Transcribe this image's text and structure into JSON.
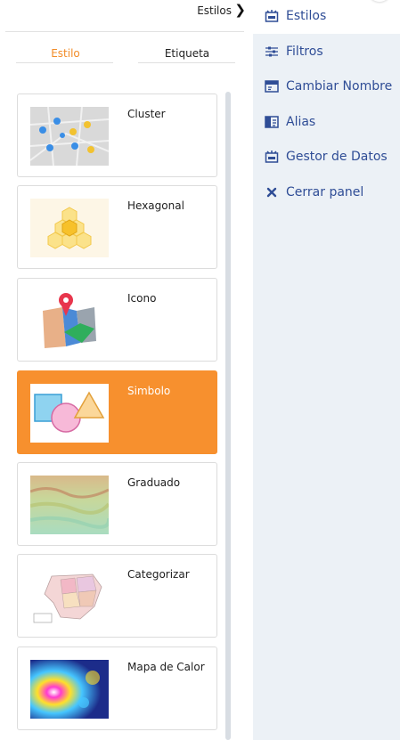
{
  "header": {
    "crumb_label": "Estilos",
    "crumb_icon": "chevron-right-icon"
  },
  "tabs": [
    {
      "label": "Estilo",
      "active": true
    },
    {
      "label": "Etiqueta",
      "active": false
    }
  ],
  "styles": [
    {
      "label": "Cluster",
      "thumb": "cluster-thumbnail",
      "selected": false
    },
    {
      "label": "Hexagonal",
      "thumb": "hexagonal-thumbnail",
      "selected": false
    },
    {
      "label": "Icono",
      "thumb": "icono-thumbnail",
      "selected": false
    },
    {
      "label": "Simbolo",
      "thumb": "simbolo-thumbnail",
      "selected": true
    },
    {
      "label": "Graduado",
      "thumb": "graduado-thumbnail",
      "selected": false
    },
    {
      "label": "Categorizar",
      "thumb": "categorizar-thumbnail",
      "selected": false
    },
    {
      "label": "Mapa de Calor",
      "thumb": "mapa-de-calor-thumbnail",
      "selected": false
    }
  ],
  "menu": [
    {
      "label": "Estilos",
      "icon": "palette-icon"
    },
    {
      "label": "Filtros",
      "icon": "sliders-icon"
    },
    {
      "label": "Cambiar Nombre",
      "icon": "rename-icon"
    },
    {
      "label": "Alias",
      "icon": "alias-icon"
    },
    {
      "label": "Gestor de Datos",
      "icon": "data-manager-icon"
    },
    {
      "label": "Cerrar panel",
      "icon": "close-icon"
    }
  ],
  "colors": {
    "accent": "#f7902e",
    "menu_text": "#2f4d96",
    "panel_bg": "#ecf1f6"
  }
}
